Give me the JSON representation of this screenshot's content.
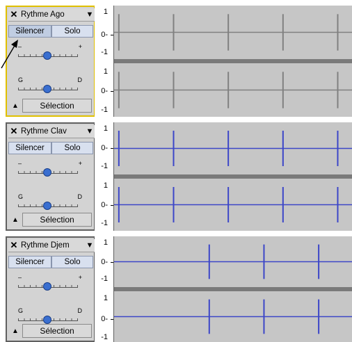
{
  "tracks": [
    {
      "name": "Rythme Ago",
      "mute_label": "Silencer",
      "solo_label": "Solo",
      "gain_left": "–",
      "gain_right": "+",
      "pan_left": "G",
      "pan_right": "D",
      "select_label": "Sélection",
      "scale_top": "1",
      "scale_mid": "0-",
      "scale_bottom": "-1",
      "selected": true,
      "muted": true,
      "wave_color": "#808080",
      "clicks": [
        0.02,
        0.25,
        0.48,
        0.71,
        0.94
      ]
    },
    {
      "name": "Rythme Clav",
      "mute_label": "Silencer",
      "solo_label": "Solo",
      "gain_left": "–",
      "gain_right": "+",
      "pan_left": "G",
      "pan_right": "D",
      "select_label": "Sélection",
      "scale_top": "1",
      "scale_mid": "0-",
      "scale_bottom": "-1",
      "selected": false,
      "muted": false,
      "wave_color": "#3c46c8",
      "clicks": [
        0.02,
        0.25,
        0.48,
        0.71,
        0.94
      ]
    },
    {
      "name": "Rythme Djem",
      "mute_label": "Silencer",
      "solo_label": "Solo",
      "gain_left": "–",
      "gain_right": "+",
      "pan_left": "G",
      "pan_right": "D",
      "select_label": "Sélection",
      "scale_top": "1",
      "scale_mid": "0-",
      "scale_bottom": "-1",
      "selected": false,
      "muted": false,
      "wave_color": "#3c46c8",
      "clicks": [
        0.4,
        0.63,
        0.86
      ]
    }
  ]
}
